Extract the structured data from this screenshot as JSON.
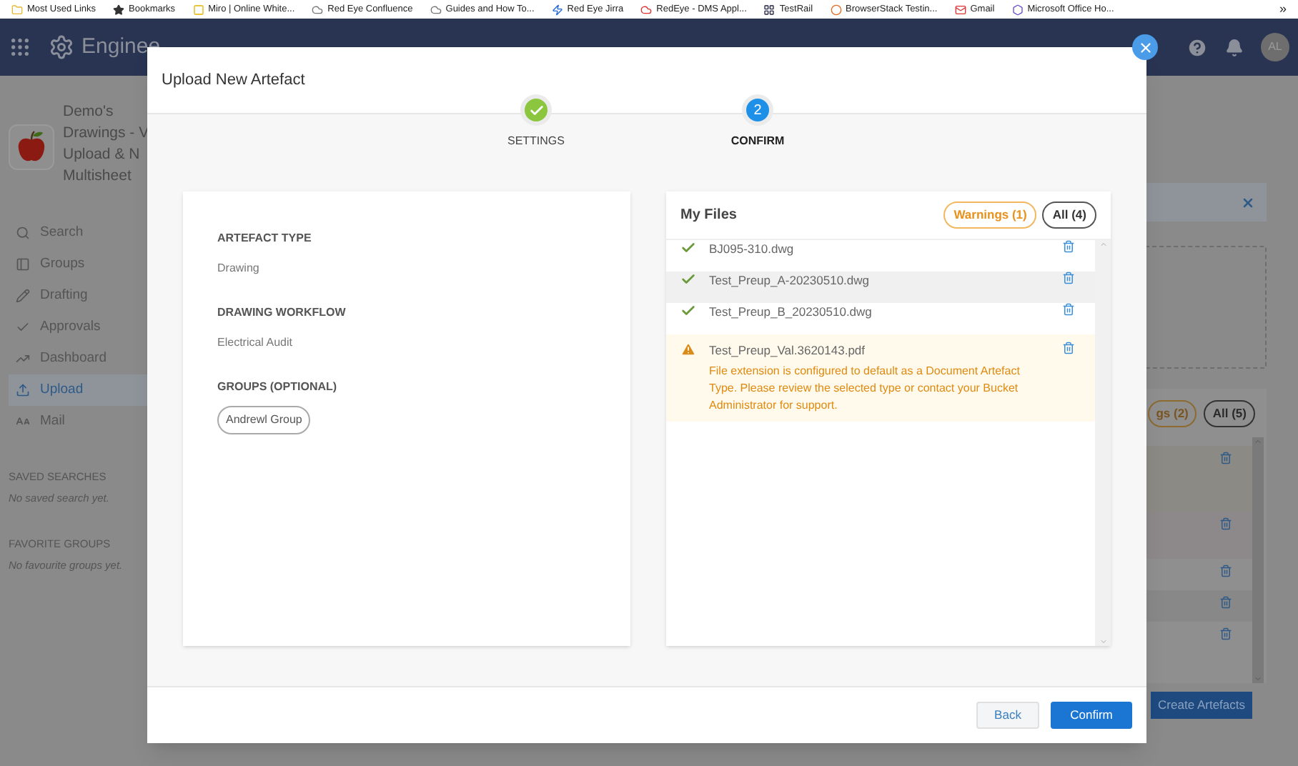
{
  "bookmarks": [
    {
      "label": "Most Used Links"
    },
    {
      "label": "Bookmarks"
    },
    {
      "label": "Miro | Online White..."
    },
    {
      "label": "Red Eye Confluence"
    },
    {
      "label": "Guides and How To..."
    },
    {
      "label": "Red Eye Jirra"
    },
    {
      "label": "RedEye - DMS Appl..."
    },
    {
      "label": "TestRail"
    },
    {
      "label": "BrowserStack Testin..."
    },
    {
      "label": "Gmail"
    },
    {
      "label": "Microsoft Office Ho..."
    }
  ],
  "bookmarks_more": "»",
  "app_header": {
    "title": "Enginee",
    "avatar": "AL"
  },
  "sidebar": {
    "workspace_name": [
      "Demo's",
      "Drawings - V",
      "Upload & N",
      "Multisheet"
    ],
    "items": [
      {
        "label": "Search",
        "selected": false
      },
      {
        "label": "Groups",
        "selected": false
      },
      {
        "label": "Drafting",
        "selected": false
      },
      {
        "label": "Approvals",
        "selected": false
      },
      {
        "label": "Dashboard",
        "selected": false
      },
      {
        "label": "Upload",
        "selected": true
      },
      {
        "label": "Mail",
        "selected": false
      }
    ],
    "saved_searches": {
      "heading": "SAVED SEARCHES",
      "empty": "No saved search yet."
    },
    "favorite_groups": {
      "heading": "FAVORITE GROUPS",
      "empty": "No favourite groups yet."
    }
  },
  "background_panel": {
    "filters": [
      {
        "label": "gs (2)",
        "kind": "warning"
      },
      {
        "label": "All (5)",
        "kind": "all"
      }
    ],
    "rows": [
      {
        "kind": "warning"
      },
      {
        "kind": "warning"
      },
      {
        "kind": "ok"
      },
      {
        "kind": "ok"
      },
      {
        "kind": "ok"
      }
    ],
    "action": "Create Artefacts"
  },
  "modal": {
    "title": "Upload New Artefact",
    "steps": [
      {
        "label": "SETTINGS",
        "kind": "done"
      },
      {
        "label": "CONFIRM",
        "kind": "current",
        "number": "2"
      }
    ],
    "settings": [
      {
        "label": "ARTEFACT TYPE",
        "value": "Drawing"
      },
      {
        "label": "DRAWING WORKFLOW",
        "value": "Electrical Audit"
      },
      {
        "label": "GROUPS (OPTIONAL)",
        "tags": [
          "Andrewl Group"
        ]
      }
    ],
    "files": {
      "title": "My Files",
      "filters": [
        {
          "label": "Warnings (1)",
          "kind": "warning"
        },
        {
          "label": "All (4)",
          "kind": "all"
        }
      ],
      "rows": [
        {
          "name": "BJ095-310.dwg",
          "kind": "ok",
          "selected": false
        },
        {
          "name": "Test_Preup_A-20230510.dwg",
          "kind": "ok",
          "selected": true
        },
        {
          "name": "Test_Preup_B_20230510.dwg",
          "kind": "ok",
          "selected": false
        },
        {
          "name": "Test_Preup_Val.3620143.pdf",
          "kind": "warning",
          "selected": false,
          "message": "File extension is configured to default as a Document Artefact Type. Please review the selected type or contact your Bucket Administrator for support."
        }
      ]
    },
    "buttons": [
      {
        "label": "Back",
        "kind": "secondary"
      },
      {
        "label": "Confirm",
        "kind": "primary"
      }
    ]
  }
}
